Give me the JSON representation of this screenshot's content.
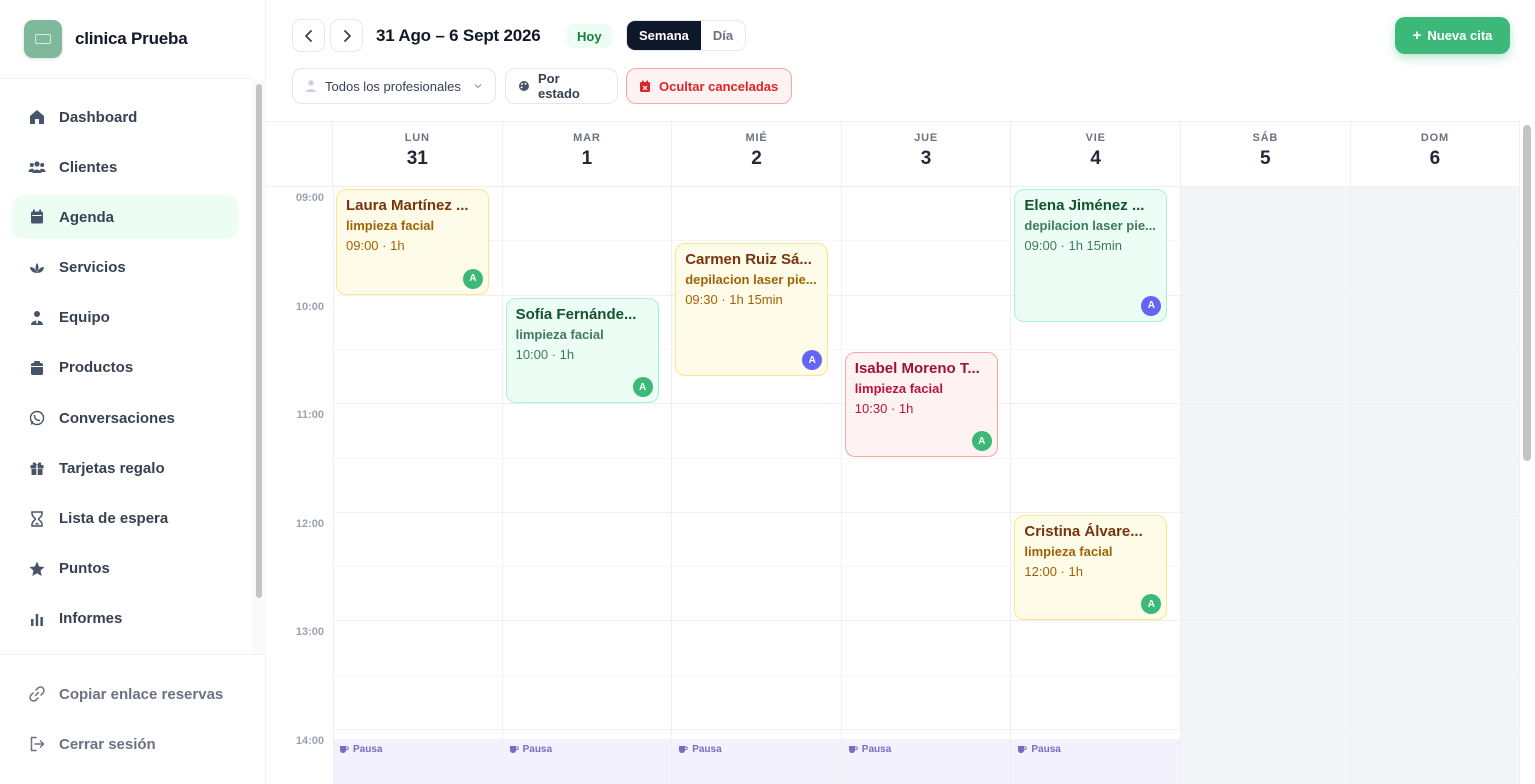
{
  "brand": {
    "name": "clinica Prueba"
  },
  "nav": [
    {
      "label": "Dashboard",
      "icon": "home-icon",
      "active": false
    },
    {
      "label": "Clientes",
      "icon": "users-icon",
      "active": false
    },
    {
      "label": "Agenda",
      "icon": "calendar-icon",
      "active": true
    },
    {
      "label": "Servicios",
      "icon": "spa-icon",
      "active": false
    },
    {
      "label": "Equipo",
      "icon": "staff-icon",
      "active": false
    },
    {
      "label": "Productos",
      "icon": "box-icon",
      "active": false
    },
    {
      "label": "Conversaciones",
      "icon": "whatsapp-icon",
      "active": false
    },
    {
      "label": "Tarjetas regalo",
      "icon": "gift-icon",
      "active": false
    },
    {
      "label": "Lista de espera",
      "icon": "hourglass-icon",
      "active": false
    },
    {
      "label": "Puntos",
      "icon": "star-icon",
      "active": false
    },
    {
      "label": "Informes",
      "icon": "bar-chart-icon",
      "active": false
    }
  ],
  "nav_bottom": [
    {
      "label": "Copiar enlace reservas",
      "icon": "link-icon"
    },
    {
      "label": "Cerrar sesión",
      "icon": "logout-icon"
    }
  ],
  "header": {
    "date_range": "31 Ago – 6 Sept 2026",
    "today_label": "Hoy",
    "view_week": "Semana",
    "view_day": "Día",
    "new_button": "Nueva cita"
  },
  "filters": {
    "professionals": "Todos los profesionales",
    "by_status": "Por estado",
    "hide_cancelled": "Ocultar canceladas"
  },
  "days": [
    {
      "name": "LUN",
      "date": "31"
    },
    {
      "name": "MAR",
      "date": "1"
    },
    {
      "name": "MIÉ",
      "date": "2"
    },
    {
      "name": "JUE",
      "date": "3"
    },
    {
      "name": "VIE",
      "date": "4"
    },
    {
      "name": "SÁB",
      "date": "5"
    },
    {
      "name": "DOM",
      "date": "6"
    }
  ],
  "times": [
    "09:00",
    "10:00",
    "11:00",
    "12:00",
    "13:00",
    "14:00"
  ],
  "pause_label": "Pausa",
  "appointments": [
    {
      "day": 0,
      "start": 9.0,
      "duration": 1.0,
      "client": "Laura Martínez ...",
      "service": "limpieza facial",
      "time": "09:00 · 1h",
      "color": "yellow",
      "avatar": "A",
      "avatar_color": "green"
    },
    {
      "day": 1,
      "start": 10.0,
      "duration": 1.0,
      "client": "Sofía Fernánde...",
      "service": "limpieza facial",
      "time": "10:00 · 1h",
      "color": "green",
      "avatar": "A",
      "avatar_color": "green"
    },
    {
      "day": 2,
      "start": 9.5,
      "duration": 1.25,
      "client": "Carmen Ruiz Sá...",
      "service": "depilacion laser pie...",
      "time": "09:30 · 1h 15min",
      "color": "yellow",
      "avatar": "A",
      "avatar_color": "purple"
    },
    {
      "day": 3,
      "start": 10.5,
      "duration": 1.0,
      "client": "Isabel Moreno T...",
      "service": "limpieza facial",
      "time": "10:30 · 1h",
      "color": "red",
      "avatar": "A",
      "avatar_color": "green"
    },
    {
      "day": 4,
      "start": 9.0,
      "duration": 1.25,
      "client": "Elena Jiménez ...",
      "service": "depilacion laser pie...",
      "time": "09:00 · 1h 15min",
      "color": "green",
      "avatar": "A",
      "avatar_color": "purple"
    },
    {
      "day": 4,
      "start": 12.0,
      "duration": 1.0,
      "client": "Cristina Álvare...",
      "service": "limpieza facial",
      "time": "12:00 · 1h",
      "color": "yellow",
      "avatar": "A",
      "avatar_color": "green"
    }
  ]
}
